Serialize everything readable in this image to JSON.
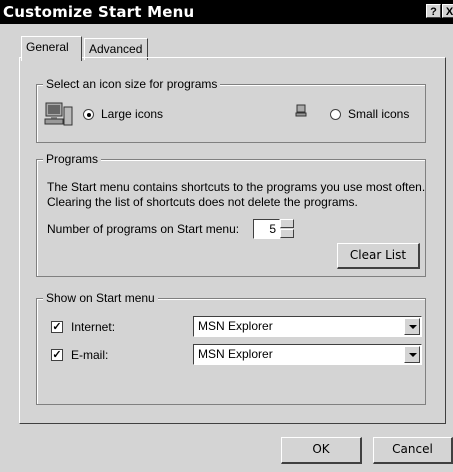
{
  "window": {
    "title": "Customize Start Menu",
    "help_button": "?",
    "close_button": "X"
  },
  "tabs": [
    {
      "label": "General"
    },
    {
      "label": "Advanced"
    }
  ],
  "icon_size": {
    "legend": "Select an icon size for programs",
    "large_label": "Large icons",
    "small_label": "Small icons",
    "selected": "large"
  },
  "programs": {
    "legend": "Programs",
    "description_line1": "The Start menu contains shortcuts to the programs you use most often.",
    "description_line2": "Clearing the list of shortcuts does not delete the programs.",
    "count_label": "Number of programs on Start menu:",
    "count_value": "5",
    "clear_button": "Clear List"
  },
  "show_on_start": {
    "legend": "Show on Start menu",
    "internet": {
      "label": "Internet:",
      "checked": true,
      "value": "MSN Explorer"
    },
    "email": {
      "label": "E-mail:",
      "checked": true,
      "value": "MSN Explorer"
    }
  },
  "footer": {
    "ok_label": "OK",
    "cancel_label": "Cancel"
  },
  "colors": {
    "titlebar": "#000000",
    "face": "#d4d4d4",
    "field": "#ffffff"
  }
}
